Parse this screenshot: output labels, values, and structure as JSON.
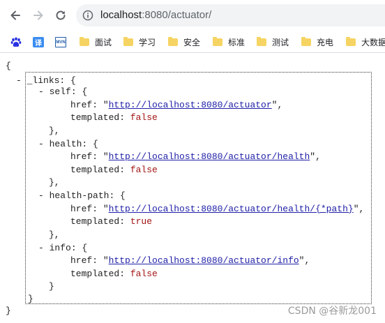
{
  "browser": {
    "url_host": "localhost",
    "url_rest": ":8080/actuator/"
  },
  "bookmarks": [
    {
      "label": "面试"
    },
    {
      "label": "学习"
    },
    {
      "label": "安全"
    },
    {
      "label": "标准"
    },
    {
      "label": "测试"
    },
    {
      "label": "充电"
    },
    {
      "label": "大数据"
    }
  ],
  "bookmark_icons": {
    "translate": "译",
    "mvn": "MVN"
  },
  "json": {
    "open": "{",
    "close": "}",
    "links_key": "_links",
    "self_key": "self",
    "health_key": "health",
    "health_path_key": "health-path",
    "info_key": "info",
    "href_key": "href",
    "templated_key": "templated",
    "self_href": "http://localhost:8080/actuator",
    "health_href": "http://localhost:8080/actuator/health",
    "health_path_href": "http://localhost:8080/actuator/health/{*path}",
    "info_href": "http://localhost:8080/actuator/info",
    "self_templated": "false",
    "health_templated": "false",
    "health_path_templated": "true",
    "info_templated": "false"
  },
  "watermark": "CSDN @谷新龙001"
}
